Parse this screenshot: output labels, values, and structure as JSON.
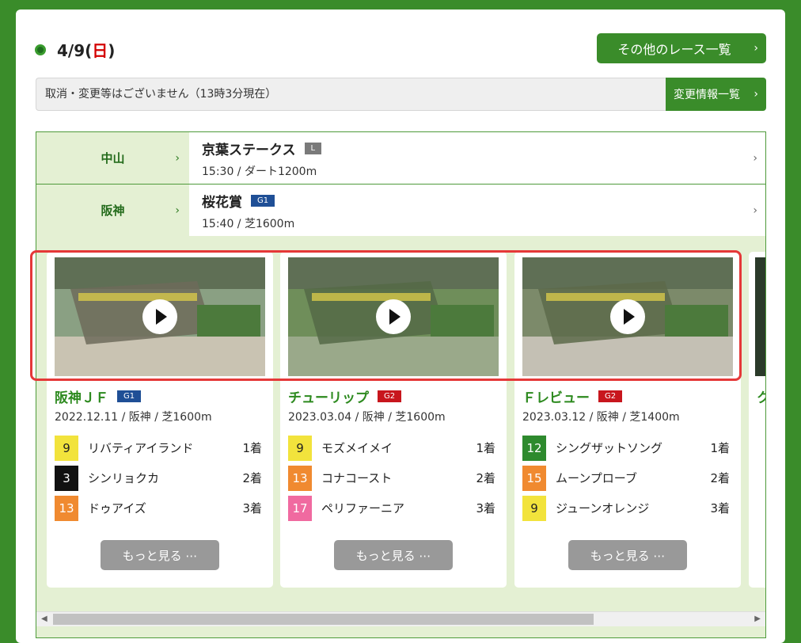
{
  "header": {
    "date": "4/9(",
    "weekday": "日",
    "date_close": ")",
    "other_races_label": "その他のレース一覧"
  },
  "notice": {
    "text": "取消・変更等はございません（13時3分現在）",
    "change_info_label": "変更情報一覧"
  },
  "races": [
    {
      "venue": "中山",
      "name": "京葉ステークス",
      "grade": "L",
      "detail": "15:30 / ダート1200m"
    },
    {
      "venue": "阪神",
      "name": "桜花賞",
      "grade": "G1",
      "detail": "15:40 / 芝1600m"
    }
  ],
  "videos": [
    {
      "title": "阪神ＪＦ",
      "grade": "G1",
      "detail": "2022.12.11 / 阪神 / 芝1600m",
      "results": [
        {
          "num": "9",
          "horse": "リバティアイランド",
          "place": "1着",
          "bg": "#f2e33c",
          "fg": "#222"
        },
        {
          "num": "3",
          "horse": "シンリョクカ",
          "place": "2着",
          "bg": "#111111",
          "fg": "#fff"
        },
        {
          "num": "13",
          "horse": "ドゥアイズ",
          "place": "3着",
          "bg": "#f08a30",
          "fg": "#fff"
        }
      ],
      "more_label": "もっと見る ⋯"
    },
    {
      "title": "チューリップ",
      "grade": "G2",
      "detail": "2023.03.04 / 阪神 / 芝1600m",
      "results": [
        {
          "num": "9",
          "horse": "モズメイメイ",
          "place": "1着",
          "bg": "#f2e33c",
          "fg": "#222"
        },
        {
          "num": "13",
          "horse": "コナコースト",
          "place": "2着",
          "bg": "#f08a30",
          "fg": "#fff"
        },
        {
          "num": "17",
          "horse": "ペリファーニア",
          "place": "3着",
          "bg": "#f06aa0",
          "fg": "#fff"
        }
      ],
      "more_label": "もっと見る ⋯"
    },
    {
      "title": "Ｆレビュー",
      "grade": "G2",
      "detail": "2023.03.12 / 阪神 / 芝1400m",
      "results": [
        {
          "num": "12",
          "horse": "シングザットソング",
          "place": "1着",
          "bg": "#2e8a2e",
          "fg": "#fff"
        },
        {
          "num": "15",
          "horse": "ムーンプローブ",
          "place": "2着",
          "bg": "#f08a30",
          "fg": "#fff"
        },
        {
          "num": "9",
          "horse": "ジューンオレンジ",
          "place": "3着",
          "bg": "#f2e33c",
          "fg": "#222"
        }
      ],
      "more_label": "もっと見る ⋯"
    }
  ],
  "partial_card_title": "ク",
  "colors": {
    "brand_green": "#3a8c2a",
    "highlight_red": "#e53838"
  }
}
